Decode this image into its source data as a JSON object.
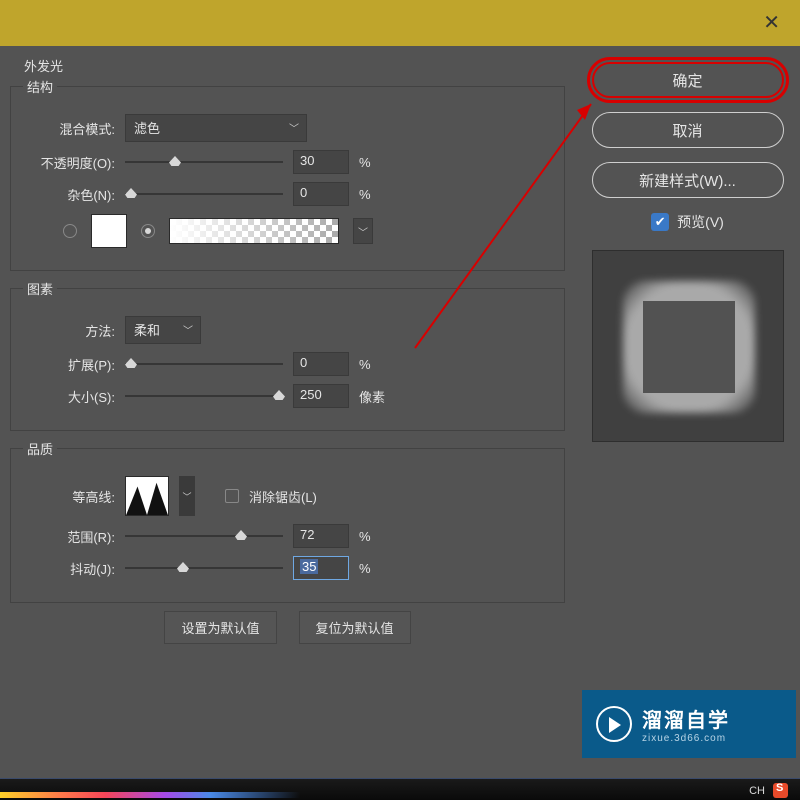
{
  "title_section": "外发光",
  "groups": {
    "structure": {
      "legend": "结构",
      "blend_mode_label": "混合模式:",
      "blend_mode_value": "滤色",
      "opacity_label": "不透明度(O):",
      "opacity_value": "30",
      "opacity_unit": "%",
      "noise_label": "杂色(N):",
      "noise_value": "0",
      "noise_unit": "%"
    },
    "elements": {
      "legend": "图素",
      "method_label": "方法:",
      "method_value": "柔和",
      "spread_label": "扩展(P):",
      "spread_value": "0",
      "spread_unit": "%",
      "size_label": "大小(S):",
      "size_value": "250",
      "size_unit": "像素"
    },
    "quality": {
      "legend": "品质",
      "contour_label": "等高线:",
      "antialias_label": "消除锯齿(L)",
      "range_label": "范围(R):",
      "range_value": "72",
      "range_unit": "%",
      "jitter_label": "抖动(J):",
      "jitter_value": "35",
      "jitter_unit": "%"
    }
  },
  "footer": {
    "set_default": "设置为默认值",
    "reset_default": "复位为默认值"
  },
  "sidebar": {
    "ok": "确定",
    "cancel": "取消",
    "new_style": "新建样式(W)...",
    "preview": "预览(V)"
  },
  "watermark": {
    "line1": "溜溜自学",
    "line2": "zixue.3d66.com"
  },
  "tray": {
    "ime": "CH"
  }
}
